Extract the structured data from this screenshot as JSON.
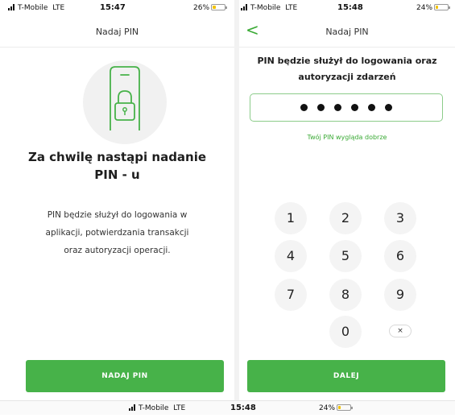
{
  "left_screen": {
    "status": {
      "carrier": "T-Mobile",
      "network": "LTE",
      "time": "15:47",
      "battery": "26%",
      "battery_fraction": 0.26
    },
    "nav_title": "Nadaj PIN",
    "illustration_icon": "phone-padlock-icon",
    "headline_line1": "Za chwilę nastąpi nadanie",
    "headline_line2": "PIN - u",
    "description_line1": "PIN będzie służył do logowania w",
    "description_line2": "aplikacji, potwierdzania transakcji",
    "description_line3": "oraz autoryzacji operacji.",
    "button_label": "NADAJ PIN"
  },
  "right_screen": {
    "status": {
      "carrier": "T-Mobile",
      "network": "LTE",
      "time": "15:48",
      "battery": "24%",
      "battery_fraction": 0.24
    },
    "back_icon": "chevron-left-icon",
    "back_glyph": "<",
    "nav_title": "Nadaj PIN",
    "pin_title_line1": "PIN będzie służył do logowania oraz",
    "pin_title_line2": "autoryzacji zdarzeń",
    "pin_dots_count": 6,
    "pin_hint": "Twój PIN wygląda dobrze",
    "keypad": {
      "k1": "1",
      "k2": "2",
      "k3": "3",
      "k4": "4",
      "k5": "5",
      "k6": "6",
      "k7": "7",
      "k8": "8",
      "k9": "9",
      "k0": "0",
      "delete_icon": "delete-x-icon",
      "delete_glyph": "×"
    },
    "button_label": "DALEJ"
  },
  "bottom_screen": {
    "status": {
      "carrier": "T-Mobile",
      "network": "LTE",
      "time": "15:48",
      "battery": "24%",
      "battery_fraction": 0.24
    }
  },
  "colors": {
    "accent": "#47b249",
    "accent_text": "#3aaa35",
    "battery_fill": "#f2c200"
  }
}
